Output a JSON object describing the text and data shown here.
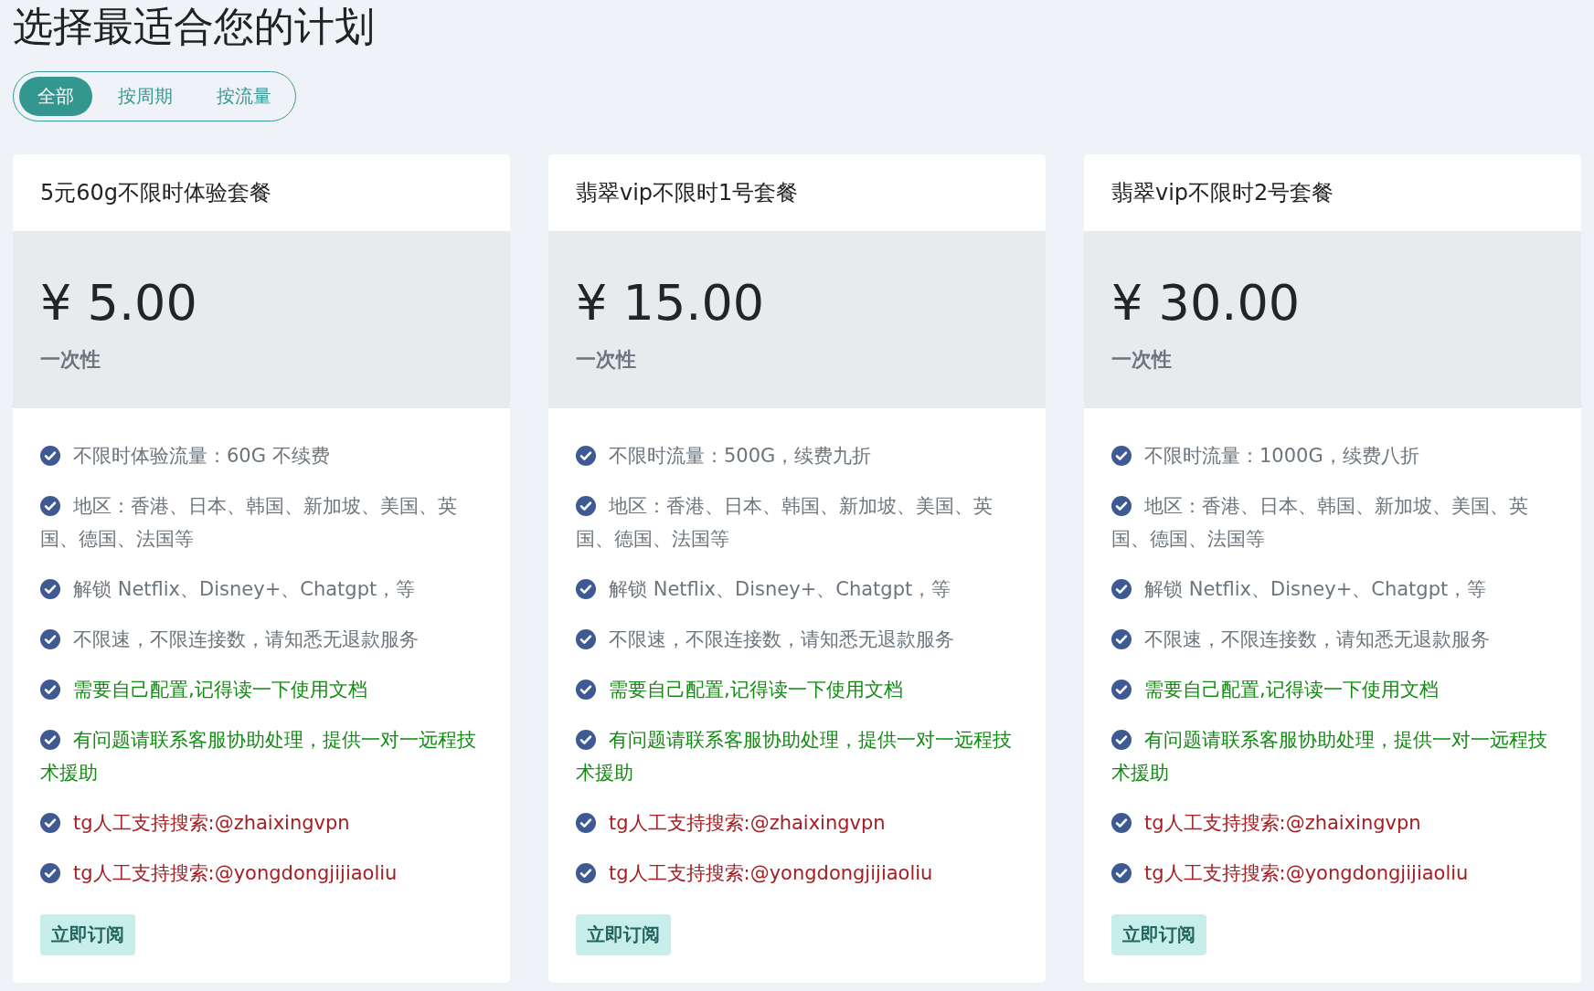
{
  "title": "选择最适合您的计划",
  "tabs": [
    {
      "label": "全部",
      "selected": true
    },
    {
      "label": "按周期",
      "selected": false
    },
    {
      "label": "按流量",
      "selected": false
    }
  ],
  "plans": [
    {
      "name": "5元60g不限时体验套餐",
      "price": "¥ 5.00",
      "period": "一次性",
      "button": "立即订阅",
      "features": [
        {
          "text": "不限时体验流量：60G 不续费",
          "kind": "plain"
        },
        {
          "text": "地区：香港、日本、韩国、新加坡、美国、英国、德国、法国等",
          "kind": "plain"
        },
        {
          "text": "解锁 Netflix、Disney+、Chatgpt，等",
          "kind": "plain"
        },
        {
          "text": "不限速，不限连接数，请知悉无退款服务",
          "kind": "plain"
        },
        {
          "text": "需要自己配置,记得读一下使用文档",
          "kind": "notice"
        },
        {
          "text": "有问题请联系客服协助处理，提供一对一远程技术援助",
          "kind": "notice"
        },
        {
          "text": "tg人工支持搜索:@zhaixingvpn",
          "kind": "contact"
        },
        {
          "text": "tg人工支持搜索:@yongdongjijiaoliu",
          "kind": "contact"
        }
      ]
    },
    {
      "name": "翡翠vip不限时1号套餐",
      "price": "¥ 15.00",
      "period": "一次性",
      "button": "立即订阅",
      "features": [
        {
          "text": "不限时流量：500G，续费九折",
          "kind": "plain"
        },
        {
          "text": "地区：香港、日本、韩国、新加坡、美国、英国、德国、法国等",
          "kind": "plain"
        },
        {
          "text": "解锁 Netflix、Disney+、Chatgpt，等",
          "kind": "plain"
        },
        {
          "text": "不限速，不限连接数，请知悉无退款服务",
          "kind": "plain"
        },
        {
          "text": "需要自己配置,记得读一下使用文档",
          "kind": "notice"
        },
        {
          "text": "有问题请联系客服协助处理，提供一对一远程技术援助",
          "kind": "notice"
        },
        {
          "text": "tg人工支持搜索:@zhaixingvpn",
          "kind": "contact"
        },
        {
          "text": "tg人工支持搜索:@yongdongjijiaoliu",
          "kind": "contact"
        }
      ]
    },
    {
      "name": "翡翠vip不限时2号套餐",
      "price": "¥ 30.00",
      "period": "一次性",
      "button": "立即订阅",
      "features": [
        {
          "text": "不限时流量：1000G，续费八折",
          "kind": "plain"
        },
        {
          "text": "地区：香港、日本、韩国、新加坡、美国、英国、德国、法国等",
          "kind": "plain"
        },
        {
          "text": "解锁 Netflix、Disney+、Chatgpt，等",
          "kind": "plain"
        },
        {
          "text": "不限速，不限连接数，请知悉无退款服务",
          "kind": "plain"
        },
        {
          "text": "需要自己配置,记得读一下使用文档",
          "kind": "notice"
        },
        {
          "text": "有问题请联系客服协助处理，提供一对一远程技术援助",
          "kind": "notice"
        },
        {
          "text": "tg人工支持搜索:@zhaixingvpn",
          "kind": "contact"
        },
        {
          "text": "tg人工支持搜索:@yongdongjijiaoliu",
          "kind": "contact"
        }
      ]
    }
  ]
}
